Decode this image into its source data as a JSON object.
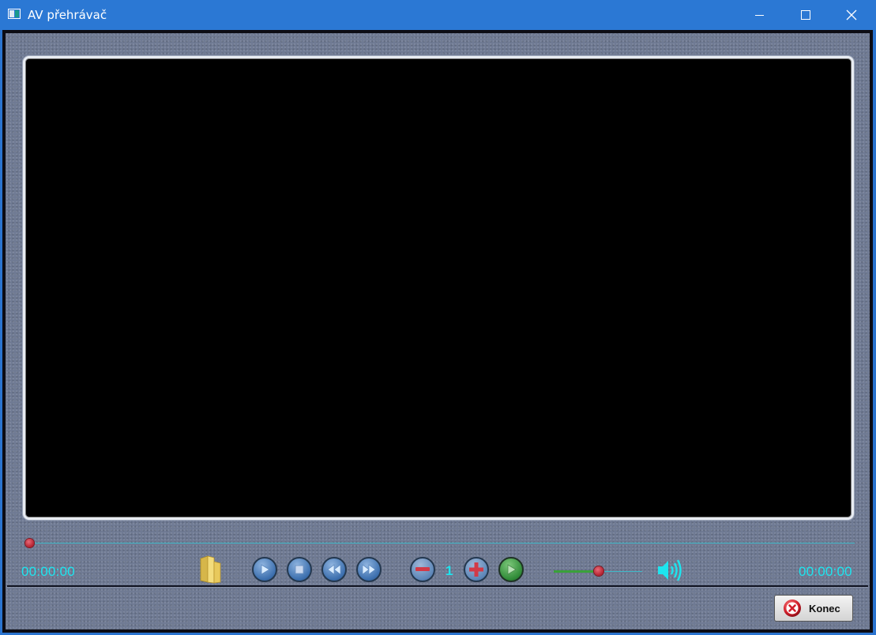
{
  "window": {
    "title": "AV přehrávač",
    "controls": [
      "minimize-icon",
      "maximize-icon",
      "close-icon"
    ],
    "titlebar_color": "#2b78d4"
  },
  "player": {
    "seek_position": 0,
    "time_elapsed": "00:00:00",
    "time_total": "00:00:00",
    "speed": "1",
    "volume_level": 0.5,
    "buttons": {
      "open": "folder-icon",
      "play": "play-icon",
      "stop": "stop-icon",
      "rewind": "rewind-icon",
      "fast_forward": "fast-forward-icon",
      "speed_down": "minus-icon",
      "speed_up": "plus-icon",
      "speed_apply": "play-green-icon",
      "volume": "speaker-icon"
    },
    "accent_color": "#1de5ef",
    "thumb_color": "#c62e3c"
  },
  "footer": {
    "exit_label": "Konec",
    "exit_icon": "close-circle-icon"
  }
}
